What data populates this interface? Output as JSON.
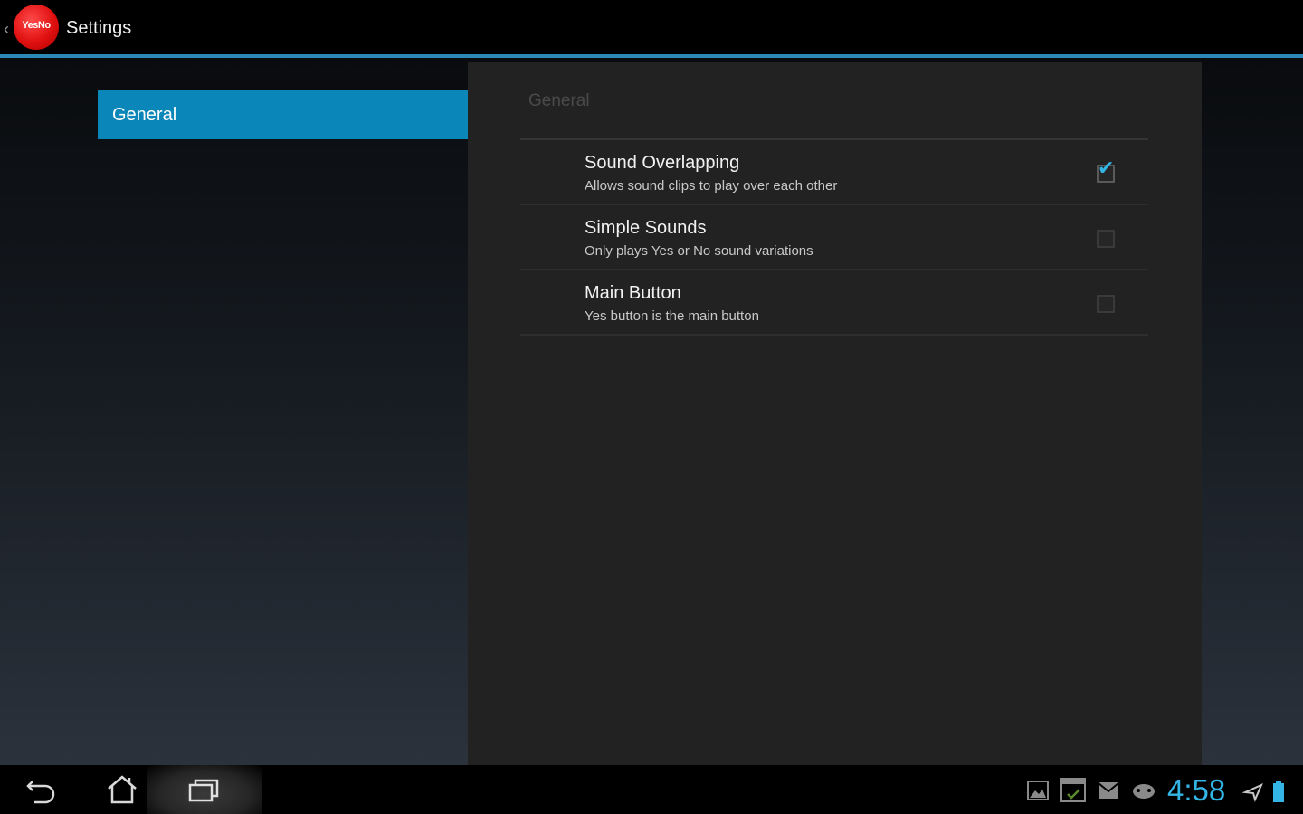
{
  "action_bar": {
    "logo_text": "YesNo",
    "title": "Settings"
  },
  "headers": [
    {
      "label": "General"
    }
  ],
  "panel": {
    "category": "General",
    "preferences": [
      {
        "title": "Sound Overlapping",
        "summary": "Allows sound clips to play over each other",
        "checked": true
      },
      {
        "title": "Simple Sounds",
        "summary": "Only plays Yes or No sound variations",
        "checked": false
      },
      {
        "title": "Main Button",
        "summary": "Yes button is the main button",
        "checked": false
      }
    ]
  },
  "system_bar": {
    "nav": [
      "back-icon",
      "home-icon",
      "recent-apps-icon"
    ],
    "notifications": [
      "gallery-icon",
      "calendar-icon",
      "email-icon",
      "gamepad-icon"
    ],
    "clock": "4:58",
    "status": [
      "airplane-mode-icon",
      "battery-icon"
    ]
  },
  "colors": {
    "accent": "#33b5e5",
    "header_selected": "#0a87b8",
    "actionbar_divider": "#2b8ab5",
    "logo": "#e01010"
  }
}
